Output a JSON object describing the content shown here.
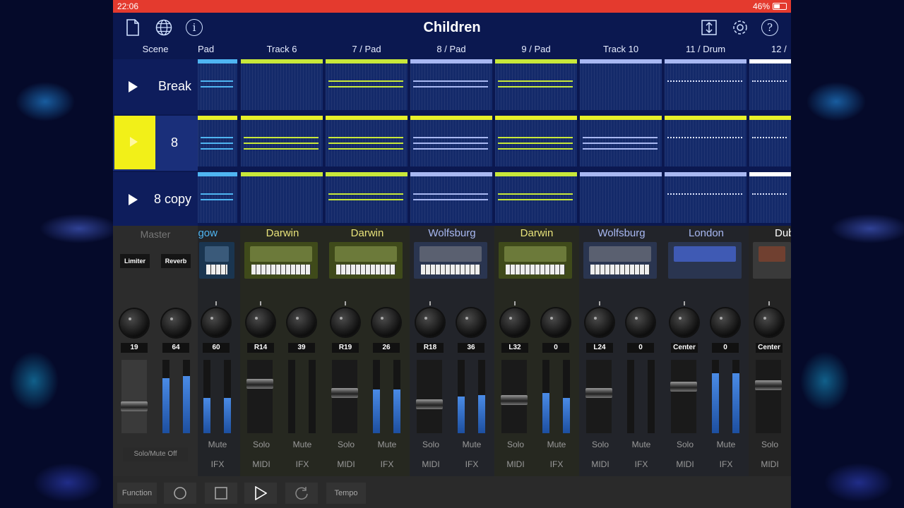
{
  "status": {
    "time": "22:06",
    "battery": "46%"
  },
  "header": {
    "title": "Children",
    "icons": {
      "new": "document-icon",
      "web": "globe-icon",
      "info": "info-icon",
      "export": "export-icon",
      "settings": "gear-icon",
      "help": "help-icon"
    }
  },
  "columns": {
    "scene": "Scene",
    "tracks": [
      "Pad",
      "Track 6",
      "7 / Pad",
      "8 / Pad",
      "9 / Pad",
      "Track 10",
      "11 / Drum",
      "12 /"
    ]
  },
  "scenes": [
    {
      "label": "Break",
      "active": false
    },
    {
      "label": "8",
      "active": true
    },
    {
      "label": "8 copy",
      "active": false
    }
  ],
  "colors": {
    "accent": "#e8f02a",
    "blue_clip": "#4fb5f2",
    "green_clip": "#c8e83a",
    "lavender_clip": "#a8b8f2",
    "status_bar": "#e43a2e"
  },
  "master": {
    "label": "Master",
    "insert_1": "Limiter",
    "insert_2": "Reverb",
    "knob_1": "19",
    "knob_2": "64",
    "solo_mute": "Solo/Mute Off",
    "fader_level": 0.35,
    "meters": [
      0.75,
      0.78
    ]
  },
  "channels": [
    {
      "name": "gow",
      "pan": "60",
      "send": "",
      "partial": true,
      "level": 0.3,
      "meters": [
        0.48,
        0.48
      ],
      "solo": "",
      "mute": "Mute",
      "bottom": "IFX"
    },
    {
      "name": "Darwin",
      "pan": "R14",
      "send": "39",
      "level": 0.7,
      "meters": [
        0,
        0
      ],
      "solo": "Solo",
      "mute": "Mute",
      "midi": "MIDI",
      "ifx": "IFX"
    },
    {
      "name": "Darwin",
      "pan": "R19",
      "send": "26",
      "level": 0.55,
      "meters": [
        0.6,
        0.6
      ],
      "solo": "Solo",
      "mute": "Mute",
      "midi": "MIDI",
      "ifx": "IFX"
    },
    {
      "name": "Wolfsburg",
      "pan": "R18",
      "send": "36",
      "level": 0.38,
      "meters": [
        0.5,
        0.52
      ],
      "solo": "Solo",
      "mute": "Mute",
      "midi": "MIDI",
      "ifx": "IFX"
    },
    {
      "name": "Darwin",
      "pan": "L32",
      "send": "0",
      "level": 0.45,
      "meters": [
        0.55,
        0.48
      ],
      "solo": "Solo",
      "mute": "Mute",
      "midi": "MIDI",
      "ifx": "IFX"
    },
    {
      "name": "Wolfsburg",
      "pan": "L24",
      "send": "0",
      "level": 0.55,
      "meters": [
        0,
        0
      ],
      "solo": "Solo",
      "mute": "Mute",
      "midi": "MIDI",
      "ifx": "IFX"
    },
    {
      "name": "London",
      "pan": "Center",
      "send": "0",
      "level": 0.65,
      "meters": [
        0.82,
        0.82
      ],
      "solo": "Solo",
      "mute": "Mute",
      "midi": "MIDI",
      "ifx": "IFX"
    },
    {
      "name": "Dub",
      "pan": "Center",
      "send": "",
      "partial": true,
      "level": 0.68,
      "meters": [
        0,
        0
      ],
      "solo": "Solo",
      "mute": "",
      "midi": "MIDI",
      "ifx": ""
    }
  ],
  "transport": {
    "function": "Function",
    "tempo": "Tempo",
    "icons": [
      "record-icon",
      "stop-icon",
      "play-icon",
      "loop-icon"
    ]
  }
}
